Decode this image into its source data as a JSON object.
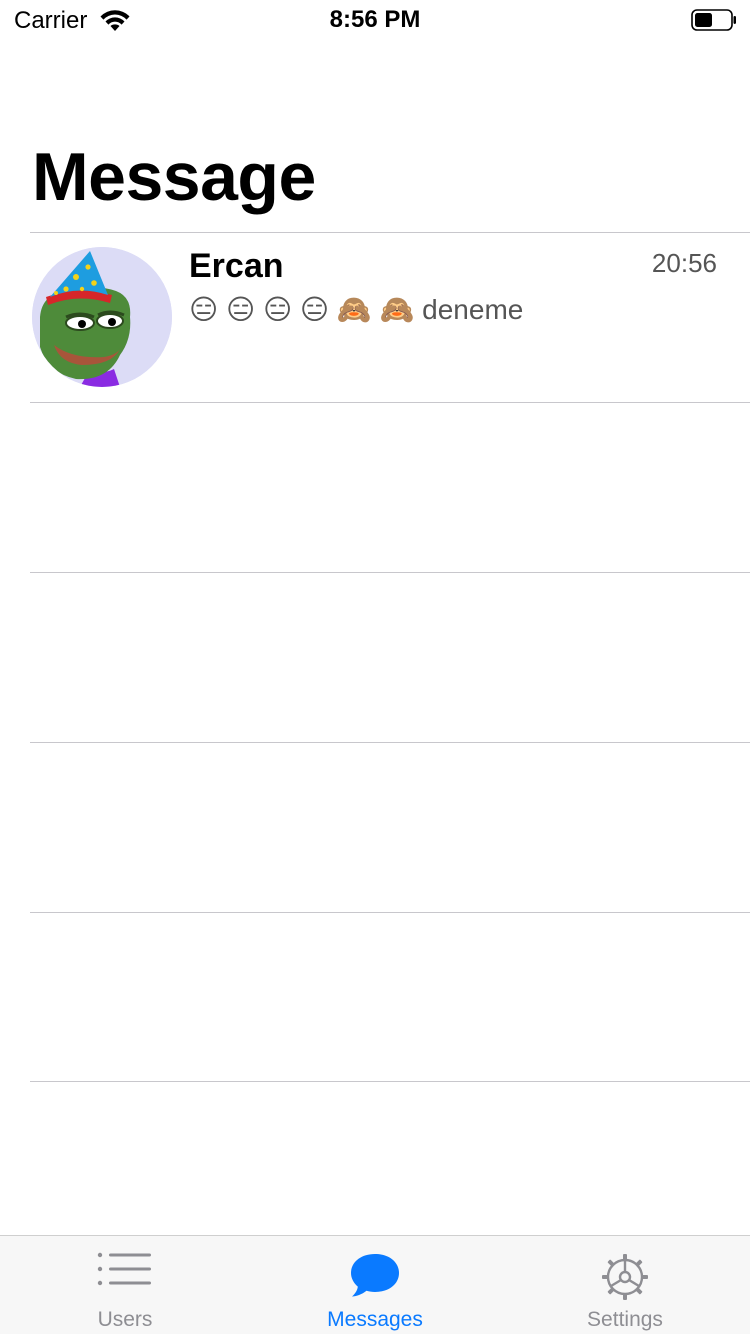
{
  "status_bar": {
    "carrier": "Carrier",
    "time": "8:56 PM"
  },
  "page": {
    "title": "Message"
  },
  "conversations": [
    {
      "name": "Ercan",
      "preview": "😑 😑 😑 😑 🙈 🙈 deneme",
      "time": "20:56",
      "avatar_icon": "frog-party-hat-avatar"
    },
    {
      "name": "",
      "preview": "",
      "time": ""
    },
    {
      "name": "",
      "preview": "",
      "time": ""
    },
    {
      "name": "",
      "preview": "",
      "time": ""
    },
    {
      "name": "",
      "preview": "",
      "time": ""
    }
  ],
  "tab_bar": {
    "tabs": [
      {
        "label": "Users",
        "icon": "list-icon",
        "active": false
      },
      {
        "label": "Messages",
        "icon": "chat-bubble-icon",
        "active": true
      },
      {
        "label": "Settings",
        "icon": "gear-icon",
        "active": false
      }
    ]
  },
  "colors": {
    "accent": "#0a7aff",
    "inactive": "#8e8e93",
    "separator": "#c8c7cc"
  }
}
